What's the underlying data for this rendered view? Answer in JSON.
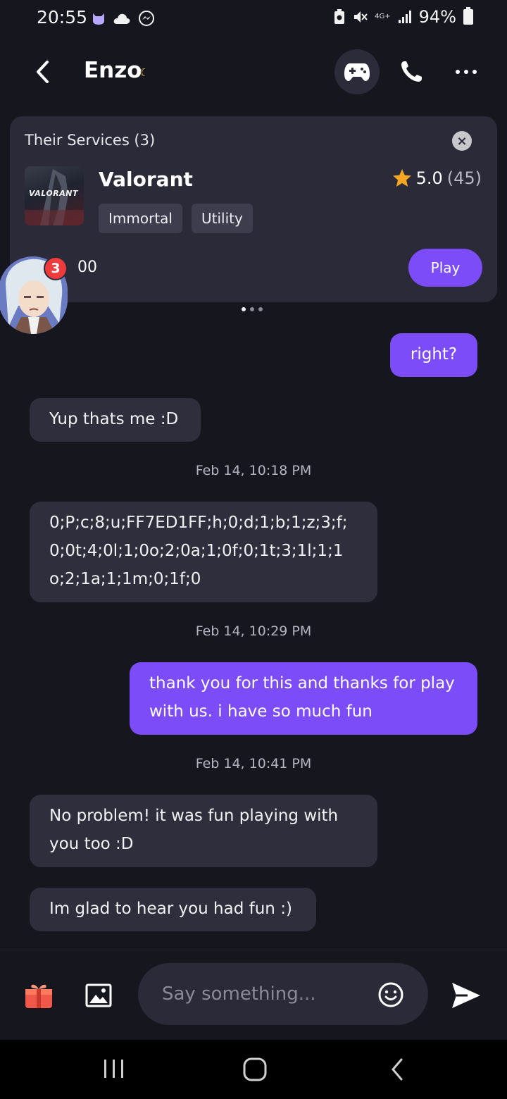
{
  "status": {
    "time": "20:55",
    "network": "4G+",
    "battery": "94%"
  },
  "header": {
    "contact_name": "Enzo"
  },
  "services": {
    "title": "Their Services (3)",
    "game": {
      "name": "Valorant",
      "logo_text": "VALORANT",
      "rating": "5.0",
      "reviews": "(45)",
      "tags": [
        "Immortal",
        "Utility"
      ],
      "price_partial": "00"
    },
    "play_label": "Play",
    "unread_badge": "3"
  },
  "messages": [
    {
      "side": "out",
      "text": "right?"
    },
    {
      "side": "in",
      "text": "Yup thats me :D"
    },
    {
      "type": "stamp",
      "text": "Feb 14, 10:18 PM"
    },
    {
      "side": "in",
      "text": "0;P;c;8;u;FF7ED1FF;h;0;d;1;b;1;z;3;f;0;0t;4;0l;1;0o;2;0a;1;0f;0;1t;3;1l;1;1o;2;1a;1;1m;0;1f;0"
    },
    {
      "type": "stamp",
      "text": "Feb 14, 10:29 PM"
    },
    {
      "side": "out",
      "text": "thank you for this and thanks for play with us. i have so much fun"
    },
    {
      "type": "stamp",
      "text": "Feb 14, 10:41 PM"
    },
    {
      "side": "in",
      "text": "No problem! it was fun playing with you too :D"
    },
    {
      "side": "in",
      "text": "Im glad to hear you had fun :)"
    }
  ],
  "composer": {
    "placeholder": "Say something..."
  },
  "colors": {
    "background": "#16161f",
    "card": "#2a2a38",
    "accent": "#7b4cf7",
    "incoming_bubble": "#2e2e3c"
  },
  "icons": [
    "back-icon",
    "gamepad-icon",
    "phone-icon",
    "more-icon",
    "close-icon",
    "star-icon",
    "gift-icon",
    "image-icon",
    "emoji-icon",
    "send-icon"
  ]
}
